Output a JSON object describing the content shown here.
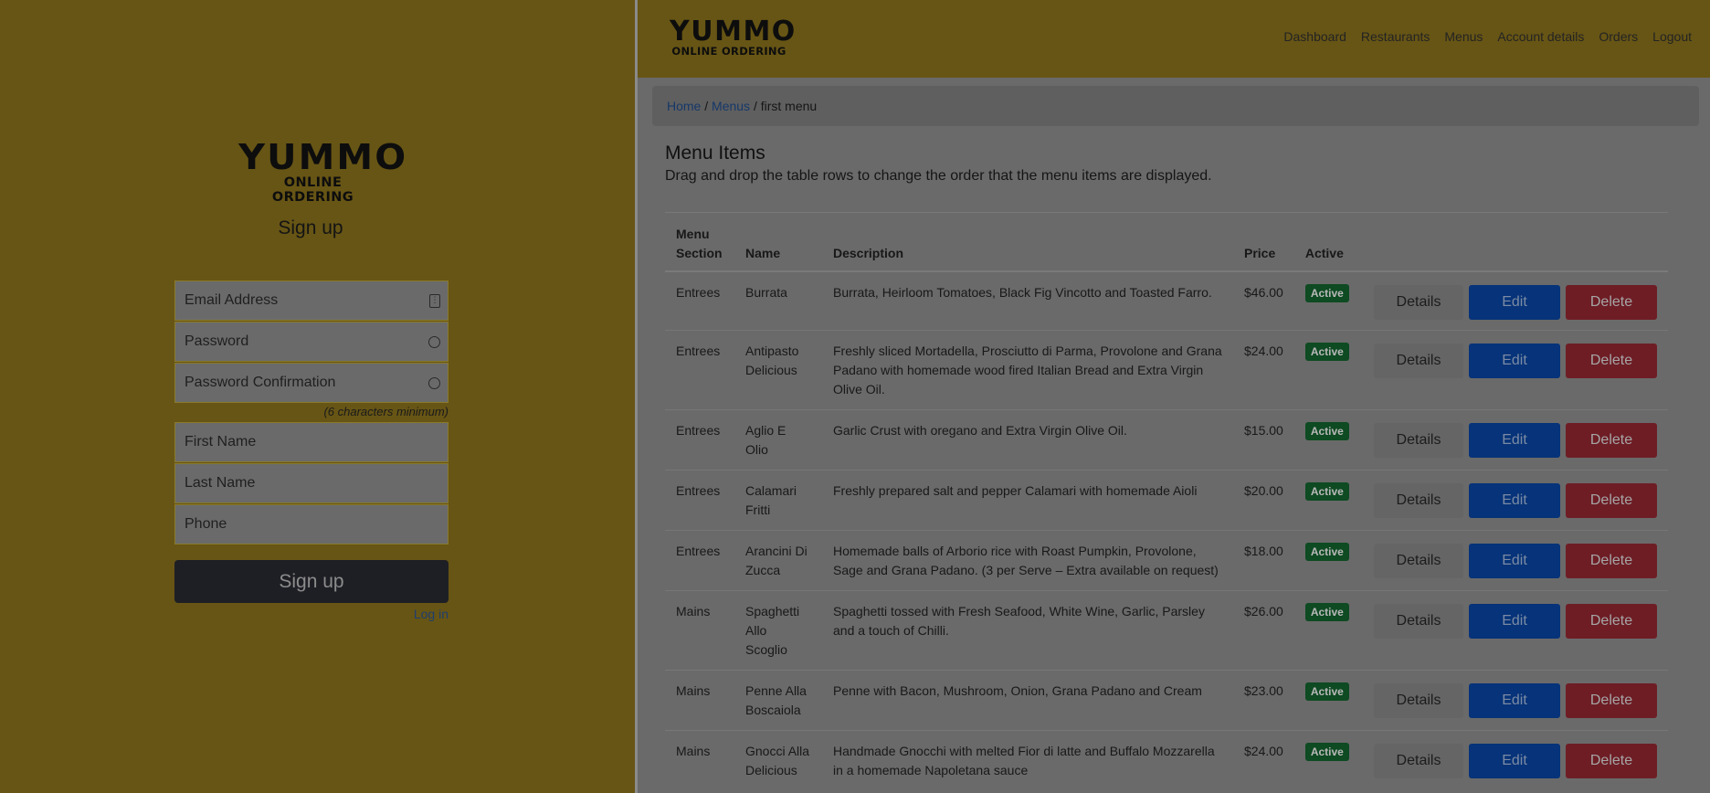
{
  "signup": {
    "logo_line1": "YUMMO",
    "logo_line2": "ONLINE ORDERING",
    "title": "Sign up",
    "email_placeholder": "Email Address",
    "password_placeholder": "Password",
    "password_confirm_placeholder": "Password Confirmation",
    "password_hint": "(6 characters minimum)",
    "first_name_placeholder": "First Name",
    "last_name_placeholder": "Last Name",
    "phone_placeholder": "Phone",
    "submit_label": "Sign up",
    "login_link": "Log in"
  },
  "header": {
    "logo_line1": "YUMMO",
    "logo_line2": "ONLINE ORDERING",
    "nav": [
      "Dashboard",
      "Restaurants",
      "Menus",
      "Account details",
      "Orders",
      "Logout"
    ]
  },
  "breadcrumb": {
    "home": "Home",
    "menus": "Menus",
    "current": "first menu",
    "sep": "/"
  },
  "page": {
    "title": "Menu Items",
    "subtitle": "Drag and drop the table rows to change the order that the menu items are displayed."
  },
  "table": {
    "headers": {
      "section": "Menu Section",
      "name": "Name",
      "description": "Description",
      "price": "Price",
      "active": "Active"
    },
    "buttons": {
      "details": "Details",
      "edit": "Edit",
      "delete": "Delete"
    },
    "rows": [
      {
        "section": "Entrees",
        "name": "Burrata",
        "description": "Burrata, Heirloom Tomatoes, Black Fig Vincotto and Toasted Farro.",
        "price": "$46.00",
        "status": "Active"
      },
      {
        "section": "Entrees",
        "name": "Antipasto Delicious",
        "description": "Freshly sliced Mortadella, Prosciutto di Parma, Provolone and Grana Padano with homemade wood fired Italian Bread and Extra Virgin Olive Oil.",
        "price": "$24.00",
        "status": "Active"
      },
      {
        "section": "Entrees",
        "name": "Aglio E Olio",
        "description": "Garlic Crust with oregano and Extra Virgin Olive Oil.",
        "price": "$15.00",
        "status": "Active"
      },
      {
        "section": "Entrees",
        "name": "Calamari Fritti",
        "description": "Freshly prepared salt and pepper Calamari with homemade Aioli",
        "price": "$20.00",
        "status": "Active"
      },
      {
        "section": "Entrees",
        "name": "Arancini Di Zucca",
        "description": "Homemade balls of Arborio rice with Roast Pumpkin, Provolone, Sage and Grana Padano. (3 per Serve – Extra available on request)",
        "price": "$18.00",
        "status": "Active"
      },
      {
        "section": "Mains",
        "name": "Spaghetti Allo Scoglio",
        "description": "Spaghetti tossed with Fresh Seafood, White Wine, Garlic, Parsley and a touch of Chilli.",
        "price": "$26.00",
        "status": "Active"
      },
      {
        "section": "Mains",
        "name": "Penne Alla Boscaiola",
        "description": "Penne with Bacon, Mushroom, Onion, Grana Padano and Cream",
        "price": "$23.00",
        "status": "Active"
      },
      {
        "section": "Mains",
        "name": "Gnocci Alla Delicious",
        "description": "Handmade Gnocchi with melted Fior di latte and Buffalo Mozzarella in a homemade Napoletana sauce",
        "price": "$24.00",
        "status": "Active"
      }
    ]
  }
}
